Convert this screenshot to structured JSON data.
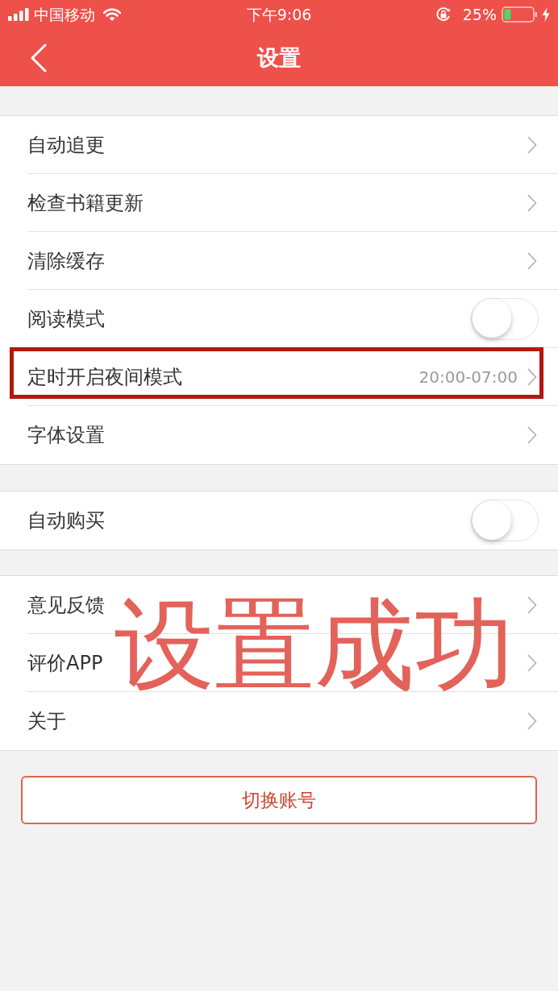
{
  "status_bar": {
    "carrier": "中国移动",
    "time": "下午9:06",
    "battery": "25%"
  },
  "nav_bar": {
    "title": "设置"
  },
  "groups": [
    {
      "items": [
        {
          "kind": "link",
          "label": "自动追更",
          "highlighted": false
        },
        {
          "kind": "link",
          "label": "检查书籍更新",
          "highlighted": false
        },
        {
          "kind": "link",
          "label": "清除缓存",
          "highlighted": false
        },
        {
          "kind": "toggle",
          "label": "阅读模式",
          "on": false,
          "highlighted": false
        },
        {
          "kind": "link",
          "label": "定时开启夜间模式",
          "value": "20:00-07:00",
          "highlighted": true
        },
        {
          "kind": "link",
          "label": "字体设置",
          "highlighted": false
        }
      ]
    },
    {
      "items": [
        {
          "kind": "toggle",
          "label": "自动购买",
          "on": false,
          "highlighted": false
        }
      ]
    },
    {
      "items": [
        {
          "kind": "link",
          "label": "意见反馈",
          "highlighted": false
        },
        {
          "kind": "link",
          "label": "评价APP",
          "highlighted": false
        },
        {
          "kind": "link",
          "label": "关于",
          "highlighted": false
        }
      ]
    }
  ],
  "button": {
    "label": "切换账号"
  },
  "annotation": {
    "text": "设置成功"
  }
}
